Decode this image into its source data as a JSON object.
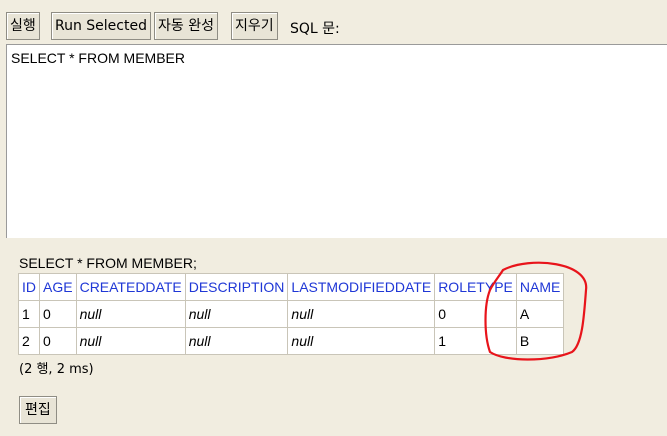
{
  "toolbar": {
    "execute_label": "실행",
    "run_selected_label": "Run Selected",
    "autocomplete_label": "자동 완성",
    "clear_label": "지우기",
    "sql_label": "SQL 문:"
  },
  "editor": {
    "value": "SELECT * FROM MEMBER"
  },
  "result": {
    "statement": "SELECT * FROM MEMBER;",
    "columns": [
      "ID",
      "AGE",
      "CREATEDDATE",
      "DESCRIPTION",
      "LASTMODIFIEDDATE",
      "ROLETYPE",
      "NAME"
    ],
    "rows": [
      [
        "1",
        "0",
        "null",
        "null",
        "null",
        "0",
        "A"
      ],
      [
        "2",
        "0",
        "null",
        "null",
        "null",
        "1",
        "B"
      ]
    ],
    "row_count": "(2 행, 2 ms)"
  },
  "edit_label": "편집",
  "colors": {
    "header_text": "#1f37d6",
    "annotation": "#e8141b",
    "background": "#f1ede0"
  }
}
